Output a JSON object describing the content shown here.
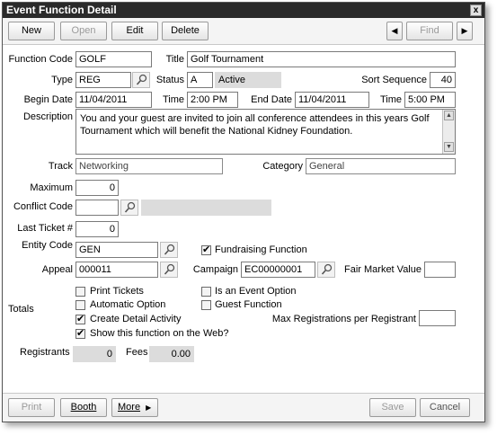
{
  "window": {
    "title": "Event Function Detail",
    "close_glyph": "x"
  },
  "toolbar": {
    "new": "New",
    "open": "Open",
    "edit": "Edit",
    "delete": "Delete",
    "prev_glyph": "◀",
    "find": "Find",
    "next_glyph": "▶"
  },
  "labels": {
    "function_code": "Function Code",
    "title": "Title",
    "type": "Type",
    "status": "Status",
    "sort_sequence": "Sort Sequence",
    "begin_date": "Begin Date",
    "time": "Time",
    "end_date": "End Date",
    "description": "Description",
    "track": "Track",
    "category": "Category",
    "maximum": "Maximum",
    "conflict_code": "Conflict Code",
    "last_ticket": "Last Ticket #",
    "entity_code": "Entity Code",
    "appeal": "Appeal",
    "campaign": "Campaign",
    "fair_market_value": "Fair Market Value",
    "totals": "Totals",
    "max_registrations": "Max Registrations per Registrant",
    "registrants": "Registrants",
    "fees": "Fees"
  },
  "values": {
    "function_code": "GOLF",
    "title": "Golf Tournament",
    "type": "REG",
    "status_code": "A",
    "status_text": "Active",
    "sort_sequence": "40",
    "begin_date": "11/04/2011",
    "begin_time": "2:00 PM",
    "end_date": "11/04/2011",
    "end_time": "5:00 PM",
    "description": "You and your guest are invited to join all conference attendees in this years Golf Tournament which will benefit the National Kidney Foundation.",
    "track": "Networking",
    "category": "General",
    "maximum": "0",
    "conflict_code": "",
    "conflict_desc": "",
    "last_ticket": "0",
    "entity_code": "GEN",
    "appeal": "000011",
    "campaign": "EC00000001",
    "fair_market_value": "",
    "max_registrations": "",
    "registrants": "0",
    "fees": "0.00"
  },
  "checkboxes": {
    "fundraising": {
      "label": "Fundraising Function",
      "checked": true
    },
    "print_tickets": {
      "label": "Print Tickets",
      "checked": false
    },
    "automatic_option": {
      "label": "Automatic Option",
      "checked": false
    },
    "create_detail_activity": {
      "label": "Create Detail Activity",
      "checked": true
    },
    "show_on_web": {
      "label": "Show this function on the Web?",
      "checked": true
    },
    "is_event_option": {
      "label": "Is an Event Option",
      "checked": false
    },
    "guest_function": {
      "label": "Guest Function",
      "checked": false
    }
  },
  "bottom": {
    "print": "Print",
    "booth": "Booth",
    "more": "More",
    "more_glyph": "▶",
    "save": "Save",
    "cancel": "Cancel"
  },
  "icons": {
    "lookup": "magnifier-icon"
  }
}
